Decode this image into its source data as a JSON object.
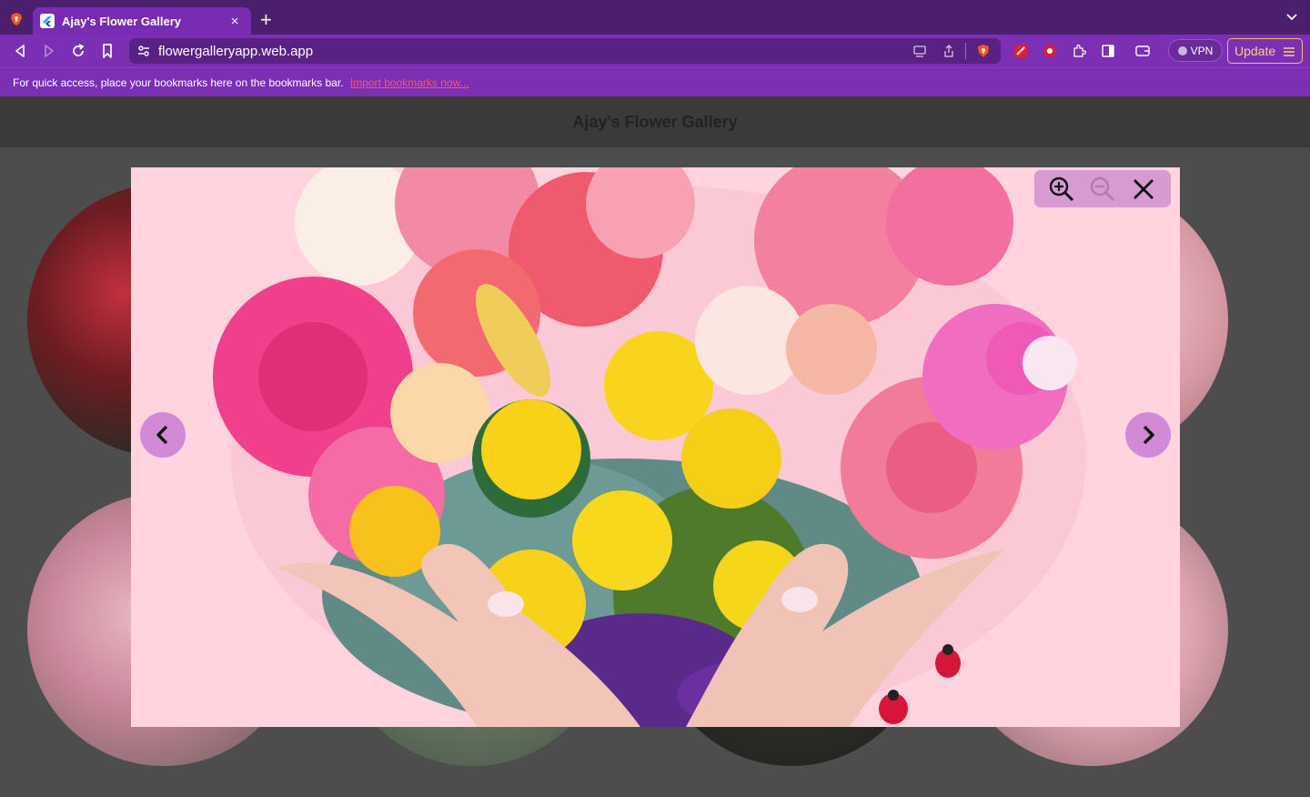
{
  "browser": {
    "tab": {
      "title": "Ajay's Flower Gallery",
      "close": "×"
    },
    "new_tab": "+",
    "address": {
      "url": "flowergalleryapp.web.app"
    },
    "vpn_label": "VPN",
    "update_label": "Update",
    "bookmarks_bar": {
      "message": "For quick access, place your bookmarks here on the bookmarks bar.",
      "link": "Import bookmarks now..."
    }
  },
  "page": {
    "title": "Ajay's Flower Gallery"
  },
  "colors": {
    "tabbar": "#4b1f6e",
    "toolbar": "#7b2fb5",
    "lightbox_bg": "#ffd6e2",
    "control_pill": "#d79ad3",
    "nav_circle": "#d38ad6"
  },
  "icons": {
    "zoom_in": "zoom-in-icon",
    "zoom_out": "zoom-out-icon",
    "close": "close-icon",
    "prev": "chevron-left-icon",
    "next": "chevron-right-icon"
  }
}
